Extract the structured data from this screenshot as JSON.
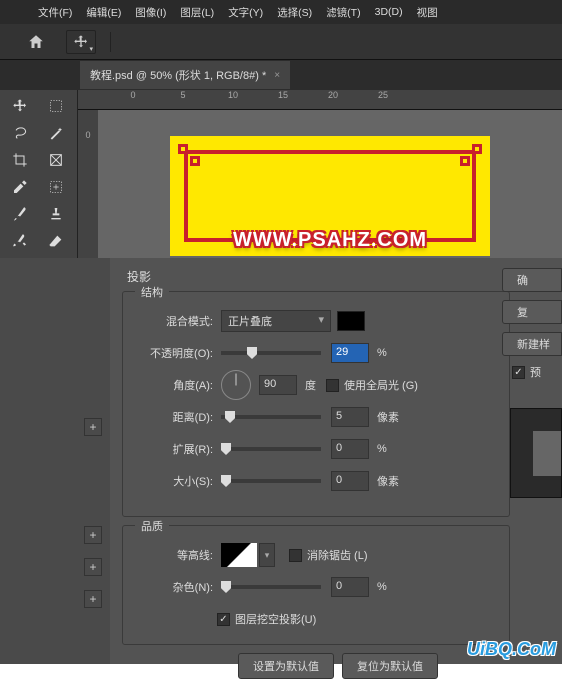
{
  "menu": {
    "items": [
      "文件(F)",
      "编辑(E)",
      "图像(I)",
      "图层(L)",
      "文字(Y)",
      "选择(S)",
      "滤镜(T)",
      "3D(D)",
      "视图"
    ]
  },
  "tab": {
    "title": "教程.psd @ 50% (形状 1, RGB/8#) *"
  },
  "ruler_h": [
    "0",
    "5",
    "10",
    "15",
    "20",
    "25"
  ],
  "ruler_v": [
    "0"
  ],
  "canvas_text": "WWW.PSAHZ.COM",
  "panel": {
    "title": "投影",
    "section1": "结构",
    "section2": "品质",
    "blend_mode_label": "混合模式:",
    "blend_mode": "正片叠底",
    "opacity_label": "不透明度(O):",
    "opacity": "29",
    "opacity_unit": "%",
    "angle_label": "角度(A):",
    "angle": "90",
    "angle_unit": "度",
    "global_light": "使用全局光 (G)",
    "distance_label": "距离(D):",
    "distance": "5",
    "distance_unit": "像素",
    "spread_label": "扩展(R):",
    "spread": "0",
    "spread_unit": "%",
    "size_label": "大小(S):",
    "size": "0",
    "size_unit": "像素",
    "contour_label": "等高线:",
    "antialias": "消除锯齿 (L)",
    "noise_label": "杂色(N):",
    "noise": "0",
    "noise_unit": "%",
    "knockout": "图层挖空投影(U)",
    "btn_default": "设置为默认值",
    "btn_reset": "复位为默认值"
  },
  "right": {
    "ok": "确",
    "cancel": "复",
    "new": "新建样",
    "preview": "预"
  },
  "watermark": "UiBQ.CoM"
}
